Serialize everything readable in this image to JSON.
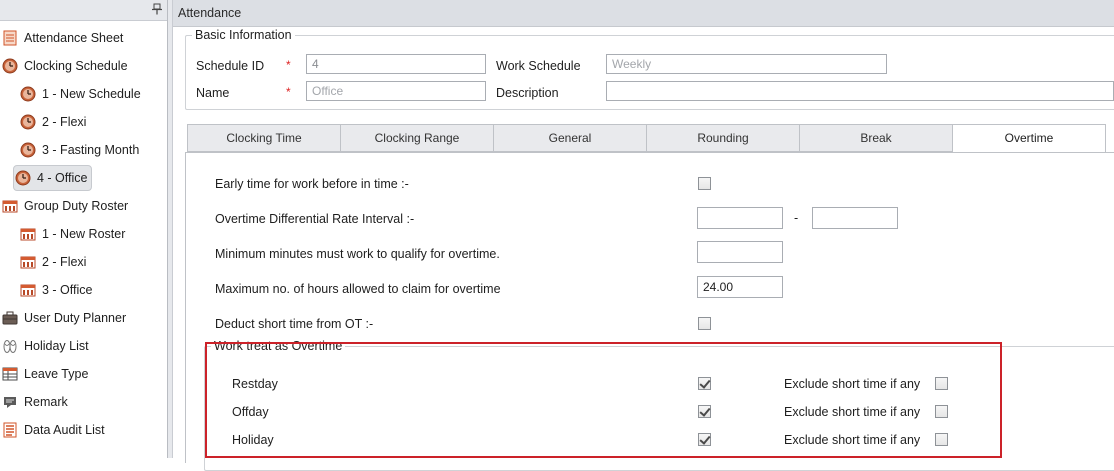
{
  "sidebar": {
    "items": [
      {
        "label": "Attendance Sheet",
        "icon": "attendance-sheet-icon"
      },
      {
        "label": "Clocking Schedule",
        "icon": "clock-icon"
      },
      {
        "label": "1 - New Schedule",
        "icon": "clock-icon"
      },
      {
        "label": "2 - Flexi",
        "icon": "clock-icon"
      },
      {
        "label": "3 - Fasting Month",
        "icon": "clock-icon"
      },
      {
        "label": "4 - Office",
        "icon": "clock-icon",
        "selected": true
      },
      {
        "label": "Group Duty Roster",
        "icon": "roster-icon"
      },
      {
        "label": "1 - New Roster",
        "icon": "roster-icon"
      },
      {
        "label": "2 - Flexi",
        "icon": "roster-icon"
      },
      {
        "label": "3 - Office",
        "icon": "roster-icon"
      },
      {
        "label": "User Duty Planner",
        "icon": "briefcase-icon"
      },
      {
        "label": "Holiday List",
        "icon": "sandals-icon"
      },
      {
        "label": "Leave Type",
        "icon": "table-icon"
      },
      {
        "label": "Remark",
        "icon": "comment-icon"
      },
      {
        "label": "Data Audit List",
        "icon": "audit-list-icon"
      }
    ]
  },
  "main": {
    "title": "Attendance",
    "basic_info": {
      "legend": "Basic Information",
      "schedule_id_label": "Schedule ID",
      "schedule_id_value": "4",
      "name_label": "Name",
      "name_placeholder": "Office",
      "work_schedule_label": "Work Schedule",
      "work_schedule_placeholder": "Weekly",
      "description_label": "Description",
      "description_value": "",
      "required_mark": "*"
    },
    "tabs": [
      "Clocking Time",
      "Clocking Range",
      "General",
      "Rounding",
      "Break",
      "Overtime"
    ],
    "active_tab": "Overtime",
    "overtime": {
      "early_time_label": "Early time for work before in time :-",
      "early_time_checked": false,
      "differential_label": "Overtime Differential Rate Interval :-",
      "differential_from": "",
      "differential_to": "",
      "differential_separator": "-",
      "min_minutes_label": "Minimum minutes must work to qualify for overtime.",
      "min_minutes_value": "",
      "max_hours_label": "Maximum no. of hours allowed to claim for overtime",
      "max_hours_value": "24.00",
      "deduct_label": "Deduct short time from OT :-",
      "deduct_checked": false,
      "work_treat": {
        "legend": "Work treat as Overtime",
        "exclude_label": "Exclude short time if any",
        "rows": [
          {
            "label": "Restday",
            "checked": true,
            "exclude_checked": false
          },
          {
            "label": "Offday",
            "checked": true,
            "exclude_checked": false
          },
          {
            "label": "Holiday",
            "checked": true,
            "exclude_checked": false
          }
        ]
      }
    }
  },
  "colors": {
    "highlight": "#cc2229",
    "required": "#dd2222",
    "header_bg": "#dcdfe4"
  }
}
